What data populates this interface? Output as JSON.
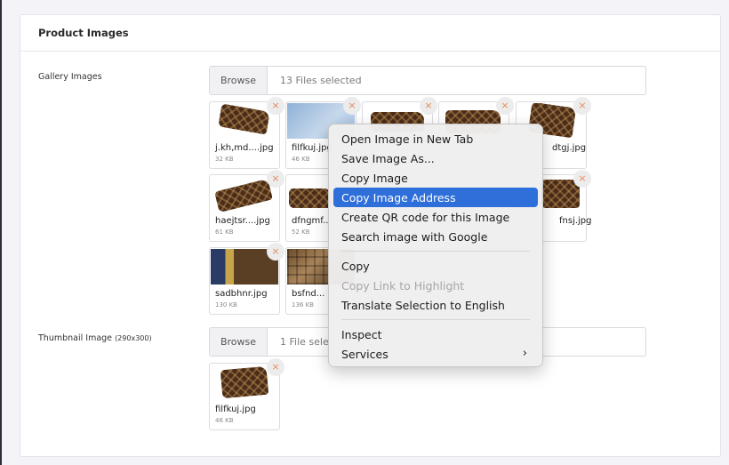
{
  "section": {
    "title": "Product Images"
  },
  "gallery": {
    "label": "Gallery Images",
    "browse_label": "Browse",
    "file_count": "13 Files selected",
    "remove_glyph": "×",
    "thumbs": [
      {
        "name": "j.kh,md....jpg",
        "size": "32 KB"
      },
      {
        "name": "filfkuj.jpg",
        "size": "46 KB"
      },
      {
        "name": "",
        "size": ""
      },
      {
        "name": "",
        "size": ""
      },
      {
        "name": "dtgj.jpg",
        "size": ""
      },
      {
        "name": "haejtsr....jpg",
        "size": "61 KB"
      },
      {
        "name": "dfngmf...",
        "size": "52 KB"
      },
      {
        "name": "fnsj.jpg",
        "size": ""
      },
      {
        "name": "sadbhnr.jpg",
        "size": "130 KB"
      },
      {
        "name": "bsfnd...",
        "size": "136 KB"
      }
    ]
  },
  "thumbnail": {
    "label": "Thumbnail Image",
    "label_dims": "(290x300)",
    "browse_label": "Browse",
    "file_count": "1 File selec",
    "thumb": {
      "name": "filfkuj.jpg",
      "size": "46 KB"
    }
  },
  "context_menu": {
    "items": [
      "Open Image in New Tab",
      "Save Image As...",
      "Copy Image",
      "Copy Image Address",
      "Create QR code for this Image",
      "Search image with Google",
      "Copy",
      "Copy Link to Highlight",
      "Translate Selection to English",
      "Inspect",
      "Services"
    ],
    "active_item": "Copy Image Address",
    "disabled_item": "Copy Link to Highlight",
    "submenu_glyph": "›"
  },
  "colors": {
    "highlight": "#2f6fd9",
    "remove_icon": "#e88a5a",
    "page_bg": "#f3f3f8"
  }
}
